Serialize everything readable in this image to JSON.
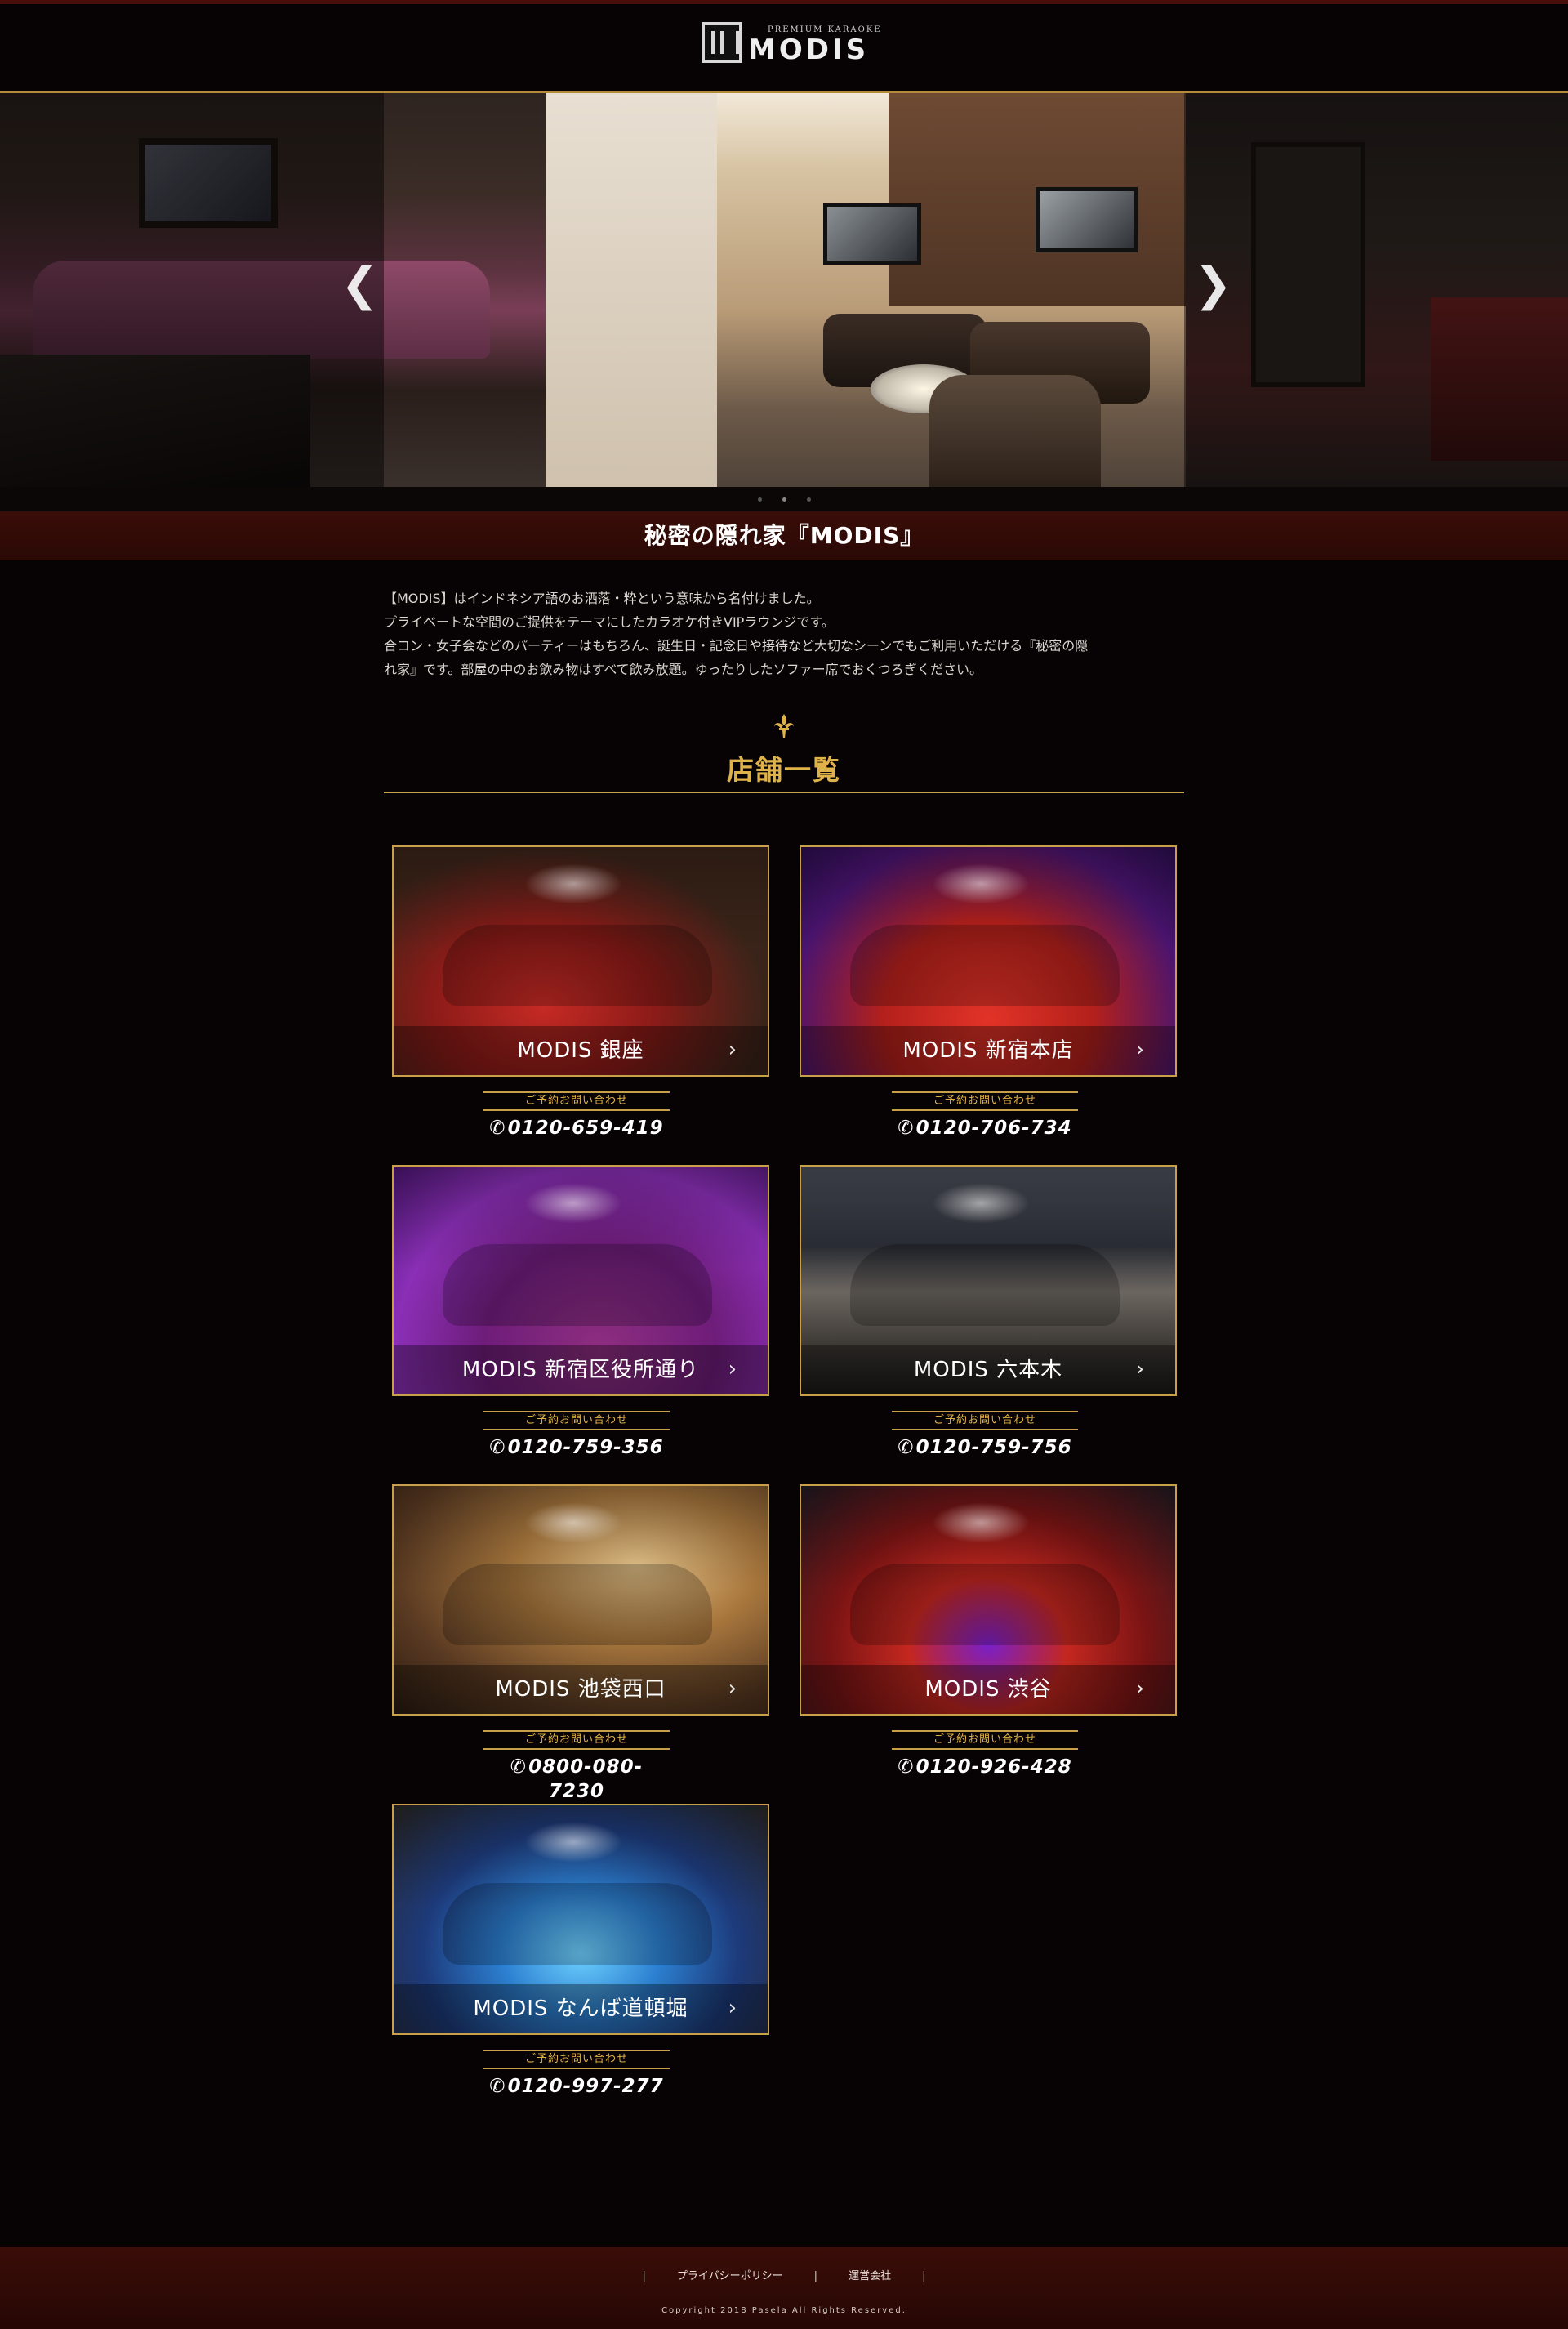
{
  "header": {
    "brand_small": "PREMIUM KARAOKE",
    "brand_name": "MODIS"
  },
  "slider": {
    "prev_icon": "chevron-left-icon",
    "next_icon": "chevron-right-icon",
    "prev_glyph": "❮",
    "next_glyph": "❯"
  },
  "intro": {
    "title": "秘密の隠れ家『MODIS』",
    "line1": "【MODIS】はインドネシア語のお洒落・粋という意味から名付けました。",
    "line2": "プライベートな空間のご提供をテーマにしたカラオケ付きVIPラウンジです。",
    "line3": "合コン・女子会などのパーティーはもちろん、誕生日・記念日や接待など大切なシーンでもご利用いただける『秘密の隠",
    "line4": "れ家』です。部屋の中のお飲み物はすべて飲み放題。ゆったりしたソファー席でおくつろぎください。"
  },
  "stores_section": {
    "title": "店舗一覧",
    "ornament_icon": "fleur-de-lis-icon",
    "contact_label": "ご予約お問い合わせ",
    "phone_icon": "phone-icon",
    "phone_glyph": "✆",
    "chevron_glyph": "›",
    "stores": [
      {
        "name": "MODIS 銀座",
        "phone": "0120-659-419"
      },
      {
        "name": "MODIS 新宿本店",
        "phone": "0120-706-734"
      },
      {
        "name": "MODIS 新宿区役所通り",
        "phone": "0120-759-356"
      },
      {
        "name": "MODIS 六本木",
        "phone": "0120-759-756"
      },
      {
        "name": "MODIS 池袋西口",
        "phone": "0800-080-7230"
      },
      {
        "name": "MODIS 渋谷",
        "phone": "0120-926-428"
      },
      {
        "name": "MODIS なんば道頓堀",
        "phone": "0120-997-277"
      }
    ]
  },
  "footer": {
    "separator": "|",
    "privacy_link": "プライバシーポリシー",
    "company_link": "運営会社",
    "copyright": "Copyright 2018 Pasela All Rights Reserved."
  },
  "colors": {
    "accent_gold": "#c9a04a",
    "title_gold": "#e0b24a",
    "band_red": "#3a0d08",
    "background": "#070304"
  }
}
